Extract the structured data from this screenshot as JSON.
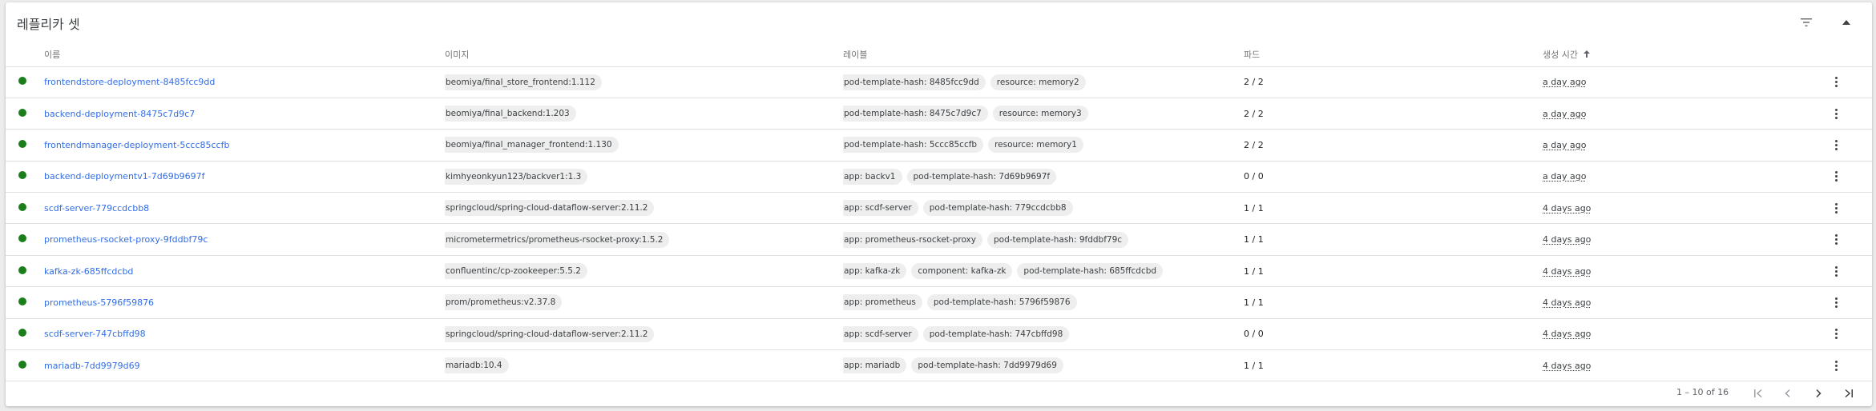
{
  "header": {
    "title": "레플리카 셋",
    "filter_icon": "filter-list-icon",
    "collapse_icon": "chevron-up-icon"
  },
  "columns": {
    "name": "이름",
    "image": "이미지",
    "labels": "레이블",
    "pods": "파드",
    "created": "생성 시간"
  },
  "rows": [
    {
      "name": "frontendstore-deployment-8485fcc9dd",
      "image": "beomiya/final_store_frontend:1.112",
      "labels": [
        "pod-template-hash: 8485fcc9dd",
        "resource: memory2"
      ],
      "pods": "2 / 2",
      "created": "a day ago"
    },
    {
      "name": "backend-deployment-8475c7d9c7",
      "image": "beomiya/final_backend:1.203",
      "labels": [
        "pod-template-hash: 8475c7d9c7",
        "resource: memory3"
      ],
      "pods": "2 / 2",
      "created": "a day ago"
    },
    {
      "name": "frontendmanager-deployment-5ccc85ccfb",
      "image": "beomiya/final_manager_frontend:1.130",
      "labels": [
        "pod-template-hash: 5ccc85ccfb",
        "resource: memory1"
      ],
      "pods": "2 / 2",
      "created": "a day ago"
    },
    {
      "name": "backend-deploymentv1-7d69b9697f",
      "image": "kimhyeonkyun123/backver1:1.3",
      "labels": [
        "app: backv1",
        "pod-template-hash: 7d69b9697f"
      ],
      "pods": "0 / 0",
      "created": "a day ago"
    },
    {
      "name": "scdf-server-779ccdcbb8",
      "image": "springcloud/spring-cloud-dataflow-server:2.11.2",
      "labels": [
        "app: scdf-server",
        "pod-template-hash: 779ccdcbb8"
      ],
      "pods": "1 / 1",
      "created": "4 days ago"
    },
    {
      "name": "prometheus-rsocket-proxy-9fddbf79c",
      "image": "micrometermetrics/prometheus-rsocket-proxy:1.5.2",
      "labels": [
        "app: prometheus-rsocket-proxy",
        "pod-template-hash: 9fddbf79c"
      ],
      "pods": "1 / 1",
      "created": "4 days ago"
    },
    {
      "name": "kafka-zk-685ffcdcbd",
      "image": "confluentinc/cp-zookeeper:5.5.2",
      "labels": [
        "app: kafka-zk",
        "component: kafka-zk",
        "pod-template-hash: 685ffcdcbd"
      ],
      "pods": "1 / 1",
      "created": "4 days ago"
    },
    {
      "name": "prometheus-5796f59876",
      "image": "prom/prometheus:v2.37.8",
      "labels": [
        "app: prometheus",
        "pod-template-hash: 5796f59876"
      ],
      "pods": "1 / 1",
      "created": "4 days ago"
    },
    {
      "name": "scdf-server-747cbffd98",
      "image": "springcloud/spring-cloud-dataflow-server:2.11.2",
      "labels": [
        "app: scdf-server",
        "pod-template-hash: 747cbffd98"
      ],
      "pods": "0 / 0",
      "created": "4 days ago"
    },
    {
      "name": "mariadb-7dd9979d69",
      "image": "mariadb:10.4",
      "labels": [
        "app: mariadb",
        "pod-template-hash: 7dd9979d69"
      ],
      "pods": "1 / 1",
      "created": "4 days ago"
    }
  ],
  "footer": {
    "range": "1 – 10 of 16"
  },
  "colors": {
    "status_ok": "#1a7f1a",
    "link": "#326de6"
  }
}
